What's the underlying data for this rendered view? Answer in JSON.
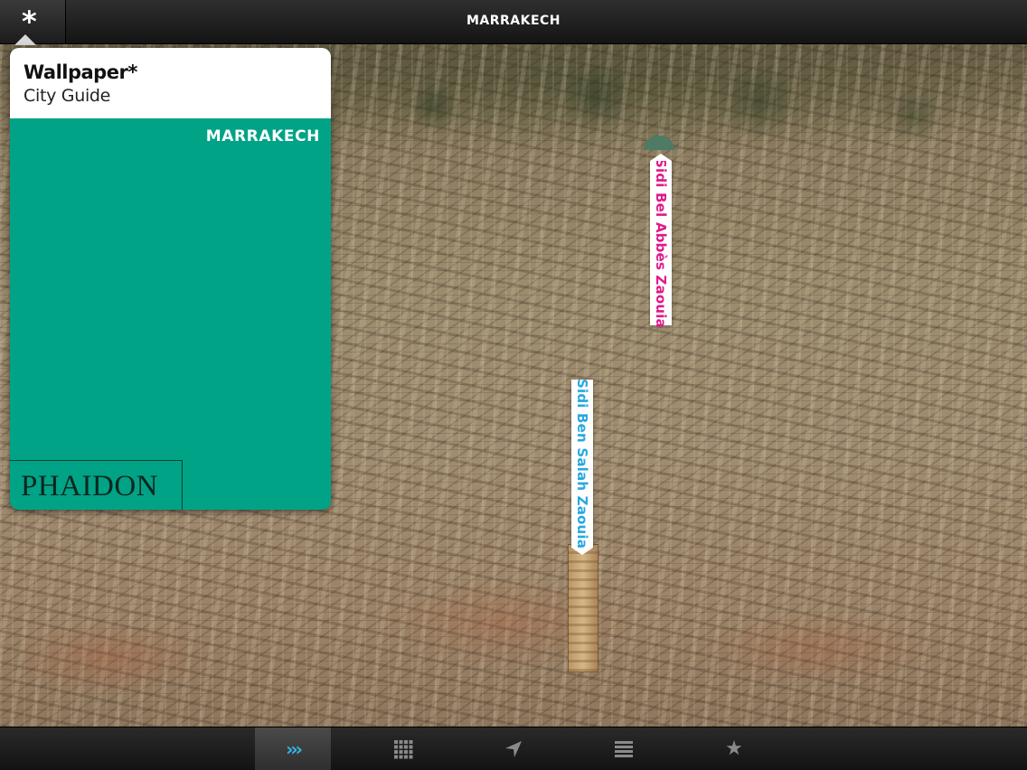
{
  "header": {
    "title": "MARRAKECH",
    "menu_icon": "asterisk-icon"
  },
  "guide_card": {
    "brand": "Wallpaper*",
    "subtitle": "City Guide",
    "city": "MARRAKECH",
    "publisher": "PHAIDON",
    "accent_color": "#00a386"
  },
  "map_labels": [
    {
      "text": "Sidi Bel Abbès Zaouia",
      "color": "#e0198a"
    },
    {
      "text": "Sidi Ben Salah Zaouia",
      "color": "#27a8df"
    }
  ],
  "toolbar": {
    "items": [
      {
        "icon": "chevrons-right-icon",
        "glyph": "›››",
        "active": true
      },
      {
        "icon": "grid-icon",
        "glyph": "",
        "active": false
      },
      {
        "icon": "location-arrow-icon",
        "glyph": "",
        "active": false
      },
      {
        "icon": "list-icon",
        "glyph": "",
        "active": false
      },
      {
        "icon": "star-icon",
        "glyph": "★",
        "active": false
      }
    ],
    "active_color": "#2fb8e8"
  }
}
